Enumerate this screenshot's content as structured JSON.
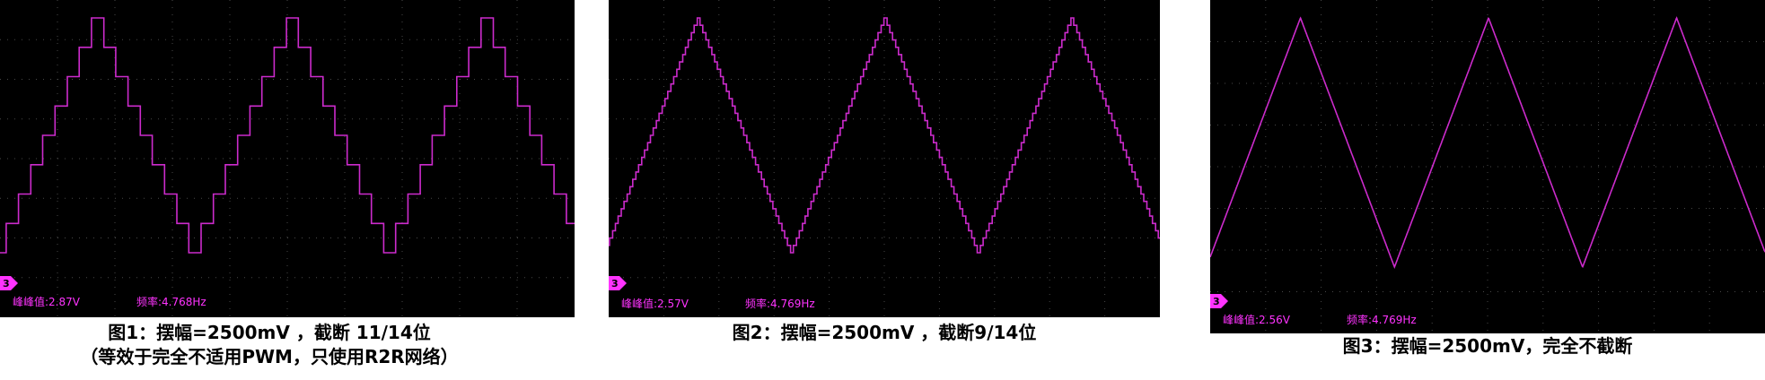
{
  "colors": {
    "trace": "#cc2bcc",
    "grid": "#5a5a5a",
    "screen": "#000000",
    "text": "#ff33ff"
  },
  "chart_data": [
    {
      "type": "line",
      "title": "",
      "channel_label": "3",
      "measurements": {
        "peak_to_peak": "峰峰值:2.87V",
        "frequency": "频率:4.768Hz"
      },
      "caption_line1": "图1：摆幅=2500mV ，截断 11/14位",
      "caption_line2": "（等效于完全不适用PWM，只使用R2R网络）",
      "waveform": "stepped-triangle",
      "quantization_levels": 8,
      "periods": 2.95,
      "phase_start": 0.0,
      "grid": true
    },
    {
      "type": "line",
      "title": "",
      "channel_label": "3",
      "measurements": {
        "peak_to_peak": "峰峰值:2.57V",
        "frequency": "频率:4.769Hz"
      },
      "caption_line1": "图2：摆幅=2500mV ，截断9/14位",
      "caption_line2": "",
      "waveform": "stepped-triangle",
      "quantization_levels": 32,
      "periods": 2.95,
      "phase_start": 0.02,
      "grid": true
    },
    {
      "type": "line",
      "title": "",
      "channel_label": "3",
      "measurements": {
        "peak_to_peak": "峰峰值:2.56V",
        "frequency": "频率:4.769Hz"
      },
      "caption_line1": "图3：摆幅=2500mV，完全不截断",
      "caption_line2": "",
      "waveform": "triangle",
      "quantization_levels": 0,
      "periods": 2.95,
      "phase_start": 0.02,
      "grid": true
    }
  ]
}
